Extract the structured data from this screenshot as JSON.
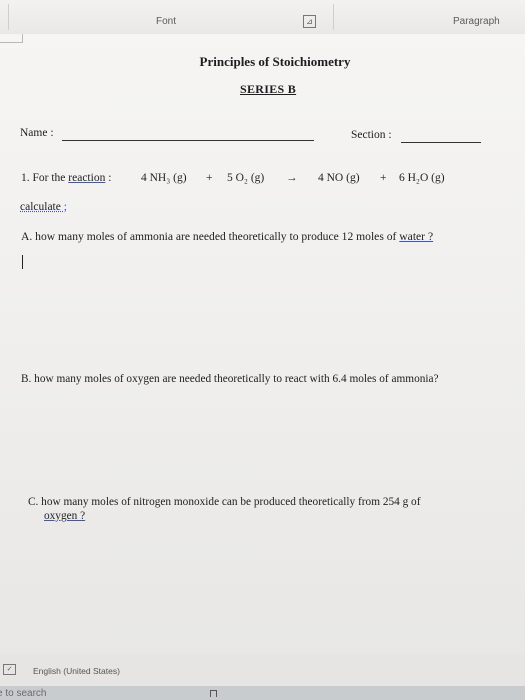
{
  "ribbon": {
    "font_group": "Font",
    "paragraph_group": "Paragraph",
    "launcher_glyph": "⊿"
  },
  "document": {
    "title": "Principles of Stoichiometry",
    "subtitle": "SERIES B",
    "name_label": "Name :",
    "section_label": "Section :",
    "q1_prefix": "1.  For the ",
    "q1_reaction_word": "reaction",
    "q1_colon": " :",
    "eq_reactant1": "4 NH₃ (g)",
    "eq_plus1": "+",
    "eq_reactant2": "5 O₂ (g)",
    "eq_arrow": "→",
    "eq_product1": "4 NO  (g)",
    "eq_plus2": "+",
    "eq_product2": "6 H₂O (g)",
    "calculate": "calculate",
    "calculate_mark": " ;",
    "qa_text": "A.  how many moles of ammonia are needed theoretically to produce 12 moles of ",
    "qa_water": "water ?",
    "qb_text": "B.  how many moles of oxygen are needed theoretically to react with 6.4 moles of ammonia?",
    "qc_text": "C.  how many moles of nitrogen monoxide can be produced theoretically from 254 g of",
    "qc_text2": "oxygen ?"
  },
  "statusbar": {
    "language": "English (United States)"
  },
  "taskbar": {
    "search_text": "e to search"
  },
  "colors": {
    "accent_underline": "#3a55c8",
    "page": "#f3f2f0"
  }
}
